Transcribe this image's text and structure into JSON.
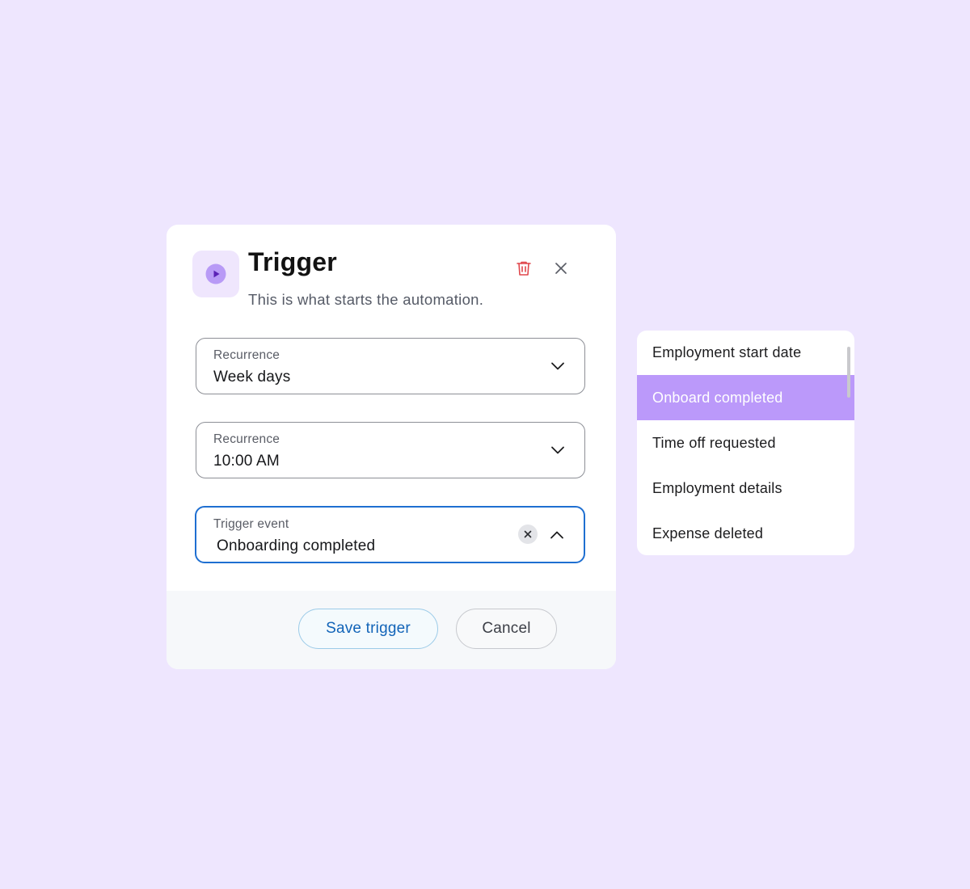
{
  "colors": {
    "background": "#eee6fe",
    "accent_purple": "#bb99fa",
    "icon_purple": "#8b5cf6",
    "active_border": "#1f6fd1",
    "delete_red": "#e0474c",
    "save_text": "#1264b8"
  },
  "dialog": {
    "title": "Trigger",
    "subtitle": "This is what starts the automation.",
    "icon": "play-icon",
    "delete_icon": "trash-icon",
    "close_icon": "close-icon"
  },
  "fields": [
    {
      "label": "Recurrence",
      "value": "Week days",
      "icon": "chevron-down-icon"
    },
    {
      "label": "Recurrence",
      "value": "10:00 AM",
      "icon": "chevron-down-icon"
    },
    {
      "label": "Trigger event",
      "value": "Onboarding completed",
      "icon": "chevron-up-icon",
      "clear_icon": "clear-icon"
    }
  ],
  "footer": {
    "save_label": "Save trigger",
    "cancel_label": "Cancel"
  },
  "dropdown": {
    "items": [
      "Employment start date",
      "Onboard completed",
      "Time off requested",
      "Employment details",
      "Expense deleted"
    ],
    "selected": "Onboard completed"
  }
}
